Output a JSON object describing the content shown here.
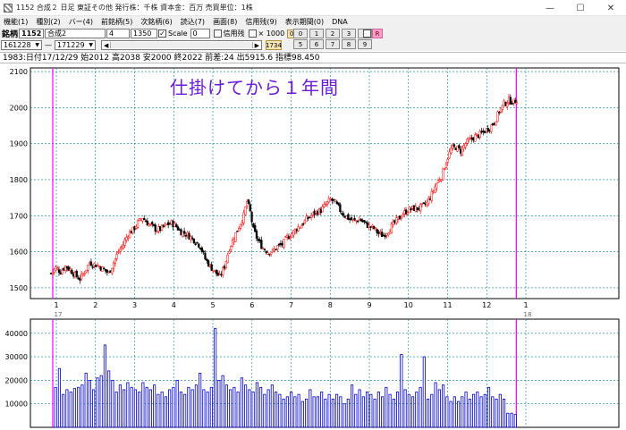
{
  "window": {
    "title": "1152 合成２ 日足  東証その他  発行株：千株  資本金：百万  売買単位：1株",
    "controls": [
      "—",
      "☐",
      "✕"
    ]
  },
  "menu": [
    "機能(1)",
    "種別(2)",
    "バー(4)",
    "前銘柄(5)",
    "次銘柄(6)",
    "読込(7)",
    "画面(8)",
    "信用残(9)",
    "表示期間(0)",
    "DNA"
  ],
  "toolbar": {
    "code_label": "銘柄",
    "code_value": "1152",
    "name_value": "合成2",
    "field_a": "4",
    "field_b": "1350",
    "scale_label": "Scale",
    "scale_input": "0",
    "margin_label": "信用残",
    "x1000_label": "× 1000",
    "badge_0": "0",
    "start_date": "161228",
    "dash": "—",
    "end_date": "171229",
    "badge_1734": "1734",
    "r_label": "R",
    "num_row1": [
      "0",
      "1",
      "2",
      "3",
      "4"
    ],
    "num_row2": [
      "5",
      "6",
      "7",
      "8",
      "9"
    ]
  },
  "info_line": "1983:日付17/12/29 始2012 高2038 安2000 終2022 前差:24 出5915.6 指標98.450",
  "overlay_text": "仕掛けてから１年間",
  "colors": {
    "up": "#ff0000",
    "down": "#000000",
    "grid": "#008080",
    "marker": "#ff00ff",
    "volume": "#0000cc",
    "overlay": "#6a1bd6"
  },
  "chart_data": [
    {
      "type": "candlestick",
      "yticks": [
        1500,
        1600,
        1700,
        1800,
        1900,
        2000,
        2100
      ],
      "ylim": [
        1470,
        2110
      ],
      "month_labels": [
        "1",
        "2",
        "3",
        "4",
        "5",
        "6",
        "7",
        "8",
        "9",
        "10",
        "11",
        "12",
        "1"
      ],
      "year_labels": [
        "17",
        "18"
      ],
      "close_path": [
        [
          0,
          1540
        ],
        [
          3,
          1555
        ],
        [
          6,
          1545
        ],
        [
          9,
          1560
        ],
        [
          12,
          1550
        ],
        [
          15,
          1535
        ],
        [
          18,
          1525
        ],
        [
          21,
          1545
        ],
        [
          24,
          1570
        ],
        [
          27,
          1565
        ],
        [
          30,
          1560
        ],
        [
          33,
          1550
        ],
        [
          36,
          1540
        ],
        [
          39,
          1570
        ],
        [
          42,
          1600
        ],
        [
          45,
          1620
        ],
        [
          48,
          1650
        ],
        [
          51,
          1660
        ],
        [
          54,
          1680
        ],
        [
          57,
          1695
        ],
        [
          60,
          1680
        ],
        [
          63,
          1670
        ],
        [
          66,
          1660
        ],
        [
          69,
          1665
        ],
        [
          72,
          1675
        ],
        [
          75,
          1680
        ],
        [
          78,
          1670
        ],
        [
          81,
          1655
        ],
        [
          84,
          1650
        ],
        [
          87,
          1640
        ],
        [
          90,
          1630
        ],
        [
          93,
          1615
        ],
        [
          96,
          1580
        ],
        [
          99,
          1560
        ],
        [
          102,
          1545
        ],
        [
          105,
          1530
        ],
        [
          108,
          1560
        ],
        [
          111,
          1610
        ],
        [
          114,
          1640
        ],
        [
          117,
          1670
        ],
        [
          120,
          1700
        ],
        [
          122,
          1740
        ],
        [
          124,
          1710
        ],
        [
          126,
          1660
        ],
        [
          129,
          1630
        ],
        [
          132,
          1610
        ],
        [
          135,
          1600
        ],
        [
          138,
          1600
        ],
        [
          141,
          1615
        ],
        [
          144,
          1620
        ],
        [
          147,
          1640
        ],
        [
          150,
          1650
        ],
        [
          153,
          1665
        ],
        [
          156,
          1675
        ],
        [
          159,
          1690
        ],
        [
          162,
          1700
        ],
        [
          165,
          1710
        ],
        [
          168,
          1715
        ],
        [
          171,
          1730
        ],
        [
          174,
          1745
        ],
        [
          177,
          1735
        ],
        [
          180,
          1715
        ],
        [
          183,
          1700
        ],
        [
          186,
          1690
        ],
        [
          189,
          1685
        ],
        [
          192,
          1690
        ],
        [
          195,
          1680
        ],
        [
          198,
          1670
        ],
        [
          201,
          1665
        ],
        [
          204,
          1650
        ],
        [
          207,
          1645
        ],
        [
          210,
          1660
        ],
        [
          213,
          1675
        ],
        [
          216,
          1690
        ],
        [
          219,
          1705
        ],
        [
          222,
          1715
        ],
        [
          225,
          1720
        ],
        [
          228,
          1720
        ],
        [
          231,
          1725
        ],
        [
          234,
          1735
        ],
        [
          237,
          1760
        ],
        [
          240,
          1790
        ],
        [
          243,
          1810
        ],
        [
          246,
          1850
        ],
        [
          249,
          1885
        ],
        [
          252,
          1890
        ],
        [
          255,
          1880
        ],
        [
          258,
          1900
        ],
        [
          261,
          1910
        ],
        [
          264,
          1920
        ],
        [
          267,
          1925
        ],
        [
          270,
          1935
        ],
        [
          273,
          1945
        ],
        [
          276,
          1960
        ],
        [
          279,
          1990
        ],
        [
          282,
          2010
        ],
        [
          285,
          2020
        ],
        [
          288,
          2015
        ],
        [
          290,
          2022
        ]
      ],
      "total_bars": 291
    },
    {
      "type": "bar",
      "yticks": [
        10000,
        20000,
        30000,
        40000
      ],
      "ylim": [
        0,
        46000
      ],
      "values": [
        17000,
        25000,
        14000,
        16000,
        15000,
        16500,
        17000,
        18000,
        23000,
        20000,
        16000,
        21000,
        22000,
        35000,
        24000,
        20000,
        15000,
        18000,
        16000,
        19000,
        17000,
        16000,
        15000,
        19000,
        17000,
        16000,
        18000,
        14000,
        15000,
        13000,
        16000,
        17000,
        20000,
        15000,
        14000,
        17000,
        16000,
        18000,
        23000,
        16000,
        15000,
        17000,
        42000,
        20000,
        22000,
        18000,
        16000,
        17000,
        15000,
        21000,
        18000,
        16000,
        15000,
        19000,
        17000,
        14000,
        16000,
        18000,
        15000,
        14000,
        12000,
        13000,
        15000,
        13000,
        14000,
        11000,
        12000,
        16000,
        13000,
        13000,
        15000,
        12000,
        14000,
        12000,
        14000,
        13000,
        10000,
        12000,
        18000,
        14000,
        16000,
        13000,
        15000,
        14000,
        12000,
        15000,
        13000,
        17000,
        14000,
        12000,
        15000,
        31000,
        16000,
        14000,
        13000,
        15000,
        17000,
        30000,
        12000,
        14000,
        19000,
        16000,
        18000,
        13000,
        11000,
        13000,
        11000,
        13000,
        15000,
        12000,
        14000,
        15000,
        13000,
        14000,
        17000,
        13000,
        12000,
        14000,
        12000,
        6000,
        6000,
        5500
      ]
    }
  ]
}
